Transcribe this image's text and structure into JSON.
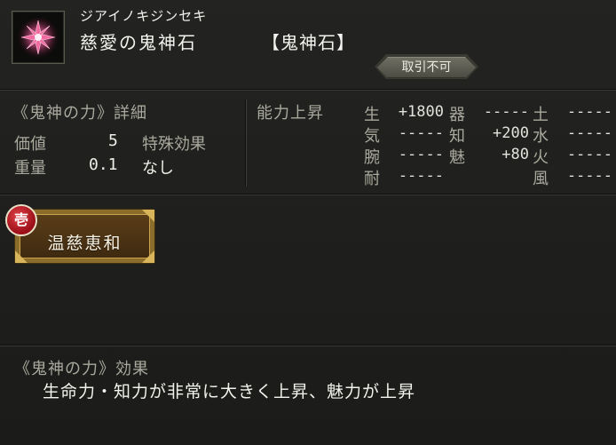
{
  "header": {
    "furigana": "ジアイノキジンセキ",
    "name": "慈愛の鬼神石",
    "type": "【鬼神石】",
    "badge": "取引不可",
    "icon": "pink-crystal-flower-icon"
  },
  "details": {
    "title": "《鬼神の力》詳細",
    "price_label": "価値",
    "price_value": "5",
    "weight_label": "重量",
    "weight_value": "0.1",
    "special_label": "特殊効果",
    "special_value": "なし"
  },
  "ability": {
    "title": "能力上昇",
    "stats": [
      {
        "k": "生",
        "v": "+1800"
      },
      {
        "k": "気",
        "v": "-----"
      },
      {
        "k": "腕",
        "v": "-----"
      },
      {
        "k": "耐",
        "v": "-----"
      },
      {
        "k": "器",
        "v": "-----"
      },
      {
        "k": "知",
        "v": "+200"
      },
      {
        "k": "魅",
        "v": "+80"
      },
      {
        "k": "土",
        "v": "-----"
      },
      {
        "k": "水",
        "v": "-----"
      },
      {
        "k": "火",
        "v": "-----"
      },
      {
        "k": "風",
        "v": "-----"
      }
    ]
  },
  "skill": {
    "num": "壱",
    "label": "温慈恵和"
  },
  "effect": {
    "title": "《鬼神の力》効果",
    "description": "生命力・知力が非常に大きく上昇、魅力が上昇"
  },
  "colors": {
    "label": "#a9a99d",
    "value": "#eeeee8",
    "background": "#1d1d1b",
    "skill_gold": "#c9a24b",
    "badge_red": "#b0141c"
  }
}
